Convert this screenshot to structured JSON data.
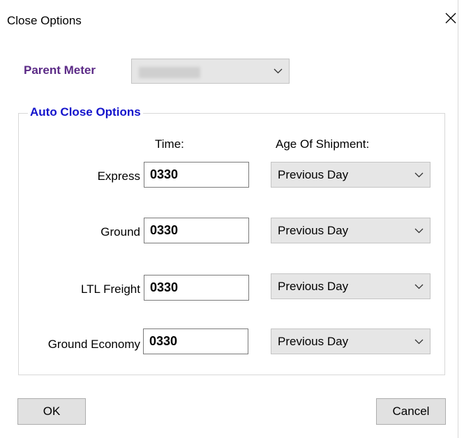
{
  "window": {
    "title": "Close Options"
  },
  "parent_meter": {
    "label": "Parent Meter",
    "value": ""
  },
  "auto_close": {
    "legend": "Auto Close Options",
    "time_header": "Time:",
    "age_header": "Age Of Shipment:",
    "rows": [
      {
        "label": "Express",
        "time": "0330",
        "age": "Previous Day"
      },
      {
        "label": "Ground",
        "time": "0330",
        "age": "Previous Day"
      },
      {
        "label": "LTL Freight",
        "time": "0330",
        "age": "Previous Day"
      },
      {
        "label": "Ground Economy",
        "time": "0330",
        "age": "Previous Day"
      }
    ]
  },
  "buttons": {
    "ok": "OK",
    "cancel": "Cancel"
  },
  "icons": {
    "close": "close-icon",
    "dropdown": "chevron-down-icon"
  },
  "colors": {
    "parent_label": "#5b2a86",
    "legend": "#1414cc",
    "combo_bg": "#e6e6e6",
    "button_bg": "#e1e1e1"
  }
}
